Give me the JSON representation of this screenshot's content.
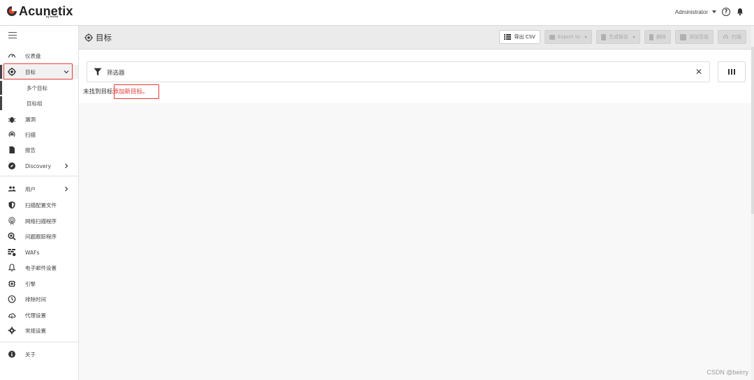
{
  "app": {
    "logo_text": "Acunetix",
    "logo_sub": "by Invicti",
    "user": "Administrator"
  },
  "sidebar": {
    "items": [
      {
        "label": "仪表盘",
        "icon": "gauge-icon"
      },
      {
        "label": "目标",
        "icon": "target-icon"
      },
      {
        "label": "多个目标",
        "icon": ""
      },
      {
        "label": "目标组",
        "icon": ""
      },
      {
        "label": "漏洞",
        "icon": "bug-icon"
      },
      {
        "label": "扫描",
        "icon": "scan-icon"
      },
      {
        "label": "报告",
        "icon": "report-icon"
      },
      {
        "label": "Discovery",
        "icon": "compass-icon"
      },
      {
        "label": "用户",
        "icon": "users-icon"
      },
      {
        "label": "扫描配置文件",
        "icon": "shield-icon"
      },
      {
        "label": "网络扫描程序",
        "icon": "network-scan-icon"
      },
      {
        "label": "问题跟踪程序",
        "icon": "issue-tracker-icon"
      },
      {
        "label": "WAFs",
        "icon": "firewall-icon"
      },
      {
        "label": "电子邮件设置",
        "icon": "bell-icon"
      },
      {
        "label": "引擎",
        "icon": "cpu-icon"
      },
      {
        "label": "排除时间",
        "icon": "clock-icon"
      },
      {
        "label": "代理设置",
        "icon": "cloud-icon"
      },
      {
        "label": "常规设置",
        "icon": "gear-icon"
      },
      {
        "label": "关于",
        "icon": "info-icon"
      }
    ]
  },
  "page": {
    "title": "目标",
    "toolbar": {
      "export_csv": "导出 CSV",
      "export_to": "Export to",
      "generate_report": "生成报告",
      "delete": "删除",
      "add_to_group": "添加至组",
      "scan": "扫描"
    },
    "filter_label": "筛选器",
    "not_found_text": "未找到目标",
    "add_link": "添加新目标。"
  },
  "watermark": "CSDN @beirry",
  "colors": {
    "accent_red": "#e53935",
    "header_bg": "#ebebeb"
  }
}
